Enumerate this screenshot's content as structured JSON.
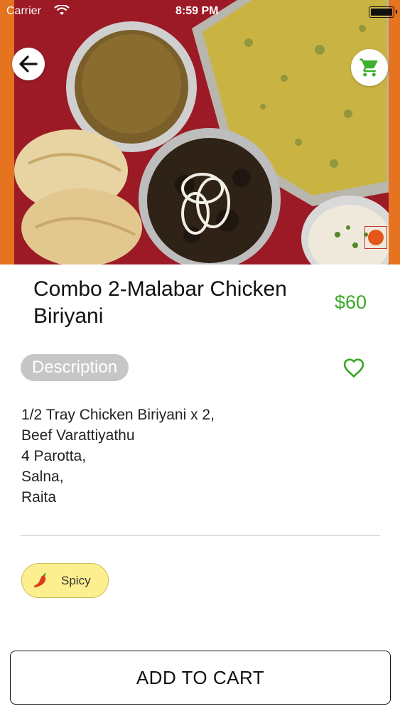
{
  "status_bar": {
    "carrier": "Carrier",
    "time": "8:59 PM"
  },
  "hero": {
    "image_alt": "food-photo"
  },
  "product": {
    "title": "Combo 2-Malabar Chicken Biriyani",
    "price": "$60",
    "description_label": "Description",
    "description_lines": [
      "1/2 Tray Chicken Biriyani x 2,",
      "Beef Varattiyathu",
      "4 Parotta,",
      "Salna,",
      "Raita"
    ]
  },
  "tags": [
    {
      "label": "Spicy",
      "icon": "chili-pepper-icon"
    }
  ],
  "actions": {
    "add_to_cart": "ADD TO CART"
  },
  "colors": {
    "price_green": "#39a825",
    "heart_green": "#39a825",
    "cart_icon_green": "#3bb02a",
    "pill_gray": "#c6c6c6",
    "tag_yellow": "#fbef8f"
  }
}
